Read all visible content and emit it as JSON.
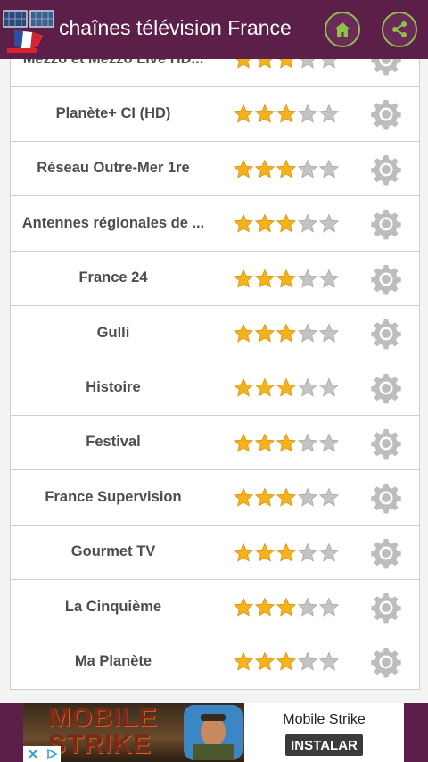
{
  "app": {
    "title": "chaînes télévision France",
    "colors": {
      "bar": "#5c1f4a",
      "accent": "#8fc04a",
      "star_on": "#f5b21c",
      "star_off": "#c4c4c4"
    },
    "buttons": {
      "home_icon": "home-icon",
      "share_icon": "share-icon"
    }
  },
  "channels": [
    {
      "name": "Mezzo et Mezzo Live HD...",
      "rating": 3,
      "max": 5,
      "action_icon": "gear-icon"
    },
    {
      "name": "Planète+ CI (HD)",
      "rating": 3,
      "max": 5,
      "action_icon": "gear-icon"
    },
    {
      "name": "Réseau Outre-Mer 1re",
      "rating": 3,
      "max": 5,
      "action_icon": "gear-icon"
    },
    {
      "name": "Antennes régionales de ...",
      "rating": 3,
      "max": 5,
      "action_icon": "gear-icon"
    },
    {
      "name": "France 24",
      "rating": 3,
      "max": 5,
      "action_icon": "gear-icon"
    },
    {
      "name": "Gulli",
      "rating": 3,
      "max": 5,
      "action_icon": "gear-icon"
    },
    {
      "name": "Histoire",
      "rating": 3,
      "max": 5,
      "action_icon": "gear-icon"
    },
    {
      "name": "Festival",
      "rating": 3,
      "max": 5,
      "action_icon": "gear-icon"
    },
    {
      "name": "France Supervision",
      "rating": 3,
      "max": 5,
      "action_icon": "gear-icon"
    },
    {
      "name": "Gourmet TV",
      "rating": 3,
      "max": 5,
      "action_icon": "gear-icon"
    },
    {
      "name": "La Cinquième",
      "rating": 3,
      "max": 5,
      "action_icon": "gear-icon"
    },
    {
      "name": "Ma Planète",
      "rating": 3,
      "max": 5,
      "action_icon": "gear-icon"
    }
  ],
  "ad": {
    "artwork_text": "MOBILE STRIKE",
    "name": "Mobile Strike",
    "install_label": "INSTALAR",
    "choices_icon": "ad-choices-icon"
  }
}
